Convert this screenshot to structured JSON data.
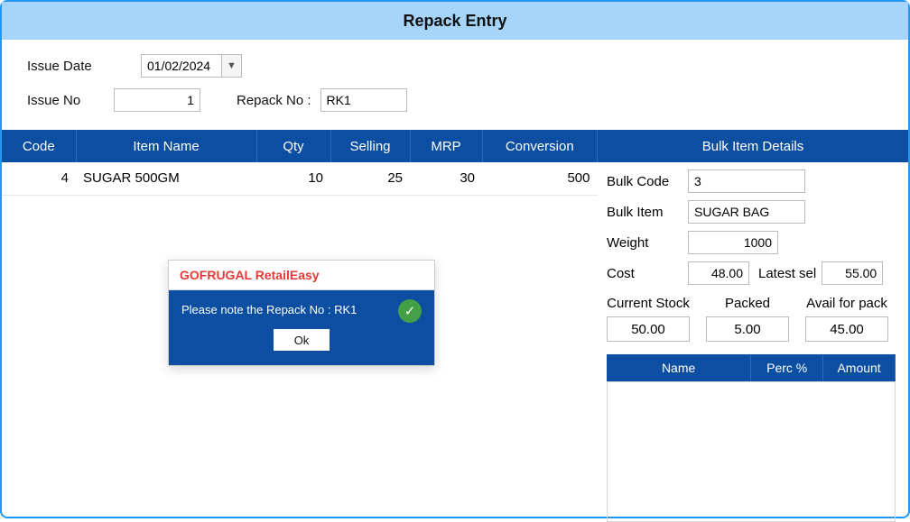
{
  "title": "Repack Entry",
  "form": {
    "issue_date_label": "Issue Date",
    "issue_date": "01/02/2024",
    "issue_no_label": "Issue No",
    "issue_no": "1",
    "repack_no_label": "Repack No :",
    "repack_no": "RK1"
  },
  "grid": {
    "headers": {
      "code": "Code",
      "item_name": "Item Name",
      "qty": "Qty",
      "selling": "Selling",
      "mrp": "MRP",
      "conversion": "Conversion"
    },
    "rows": [
      {
        "code": "4",
        "item_name": "SUGAR 500GM",
        "qty": "10",
        "selling": "25",
        "mrp": "30",
        "conversion": "500"
      }
    ]
  },
  "bulk": {
    "header": "Bulk Item Details",
    "code_label": "Bulk Code",
    "code": "3",
    "item_label": "Bulk Item",
    "item": "SUGAR BAG",
    "weight_label": "Weight",
    "weight": "1000",
    "cost_label": "Cost",
    "cost": "48.00",
    "latest_sel_label": "Latest sel",
    "latest_sel": "55.00",
    "current_stock_label": "Current Stock",
    "current_stock": "50.00",
    "packed_label": "Packed",
    "packed": "5.00",
    "avail_label": "Avail for pack",
    "avail": "45.00",
    "mini_headers": {
      "name": "Name",
      "perc": "Perc %",
      "amount": "Amount"
    }
  },
  "dialog": {
    "title": "GOFRUGAL RetailEasy",
    "message": "Please note the Repack No : RK1",
    "ok": "Ok"
  }
}
